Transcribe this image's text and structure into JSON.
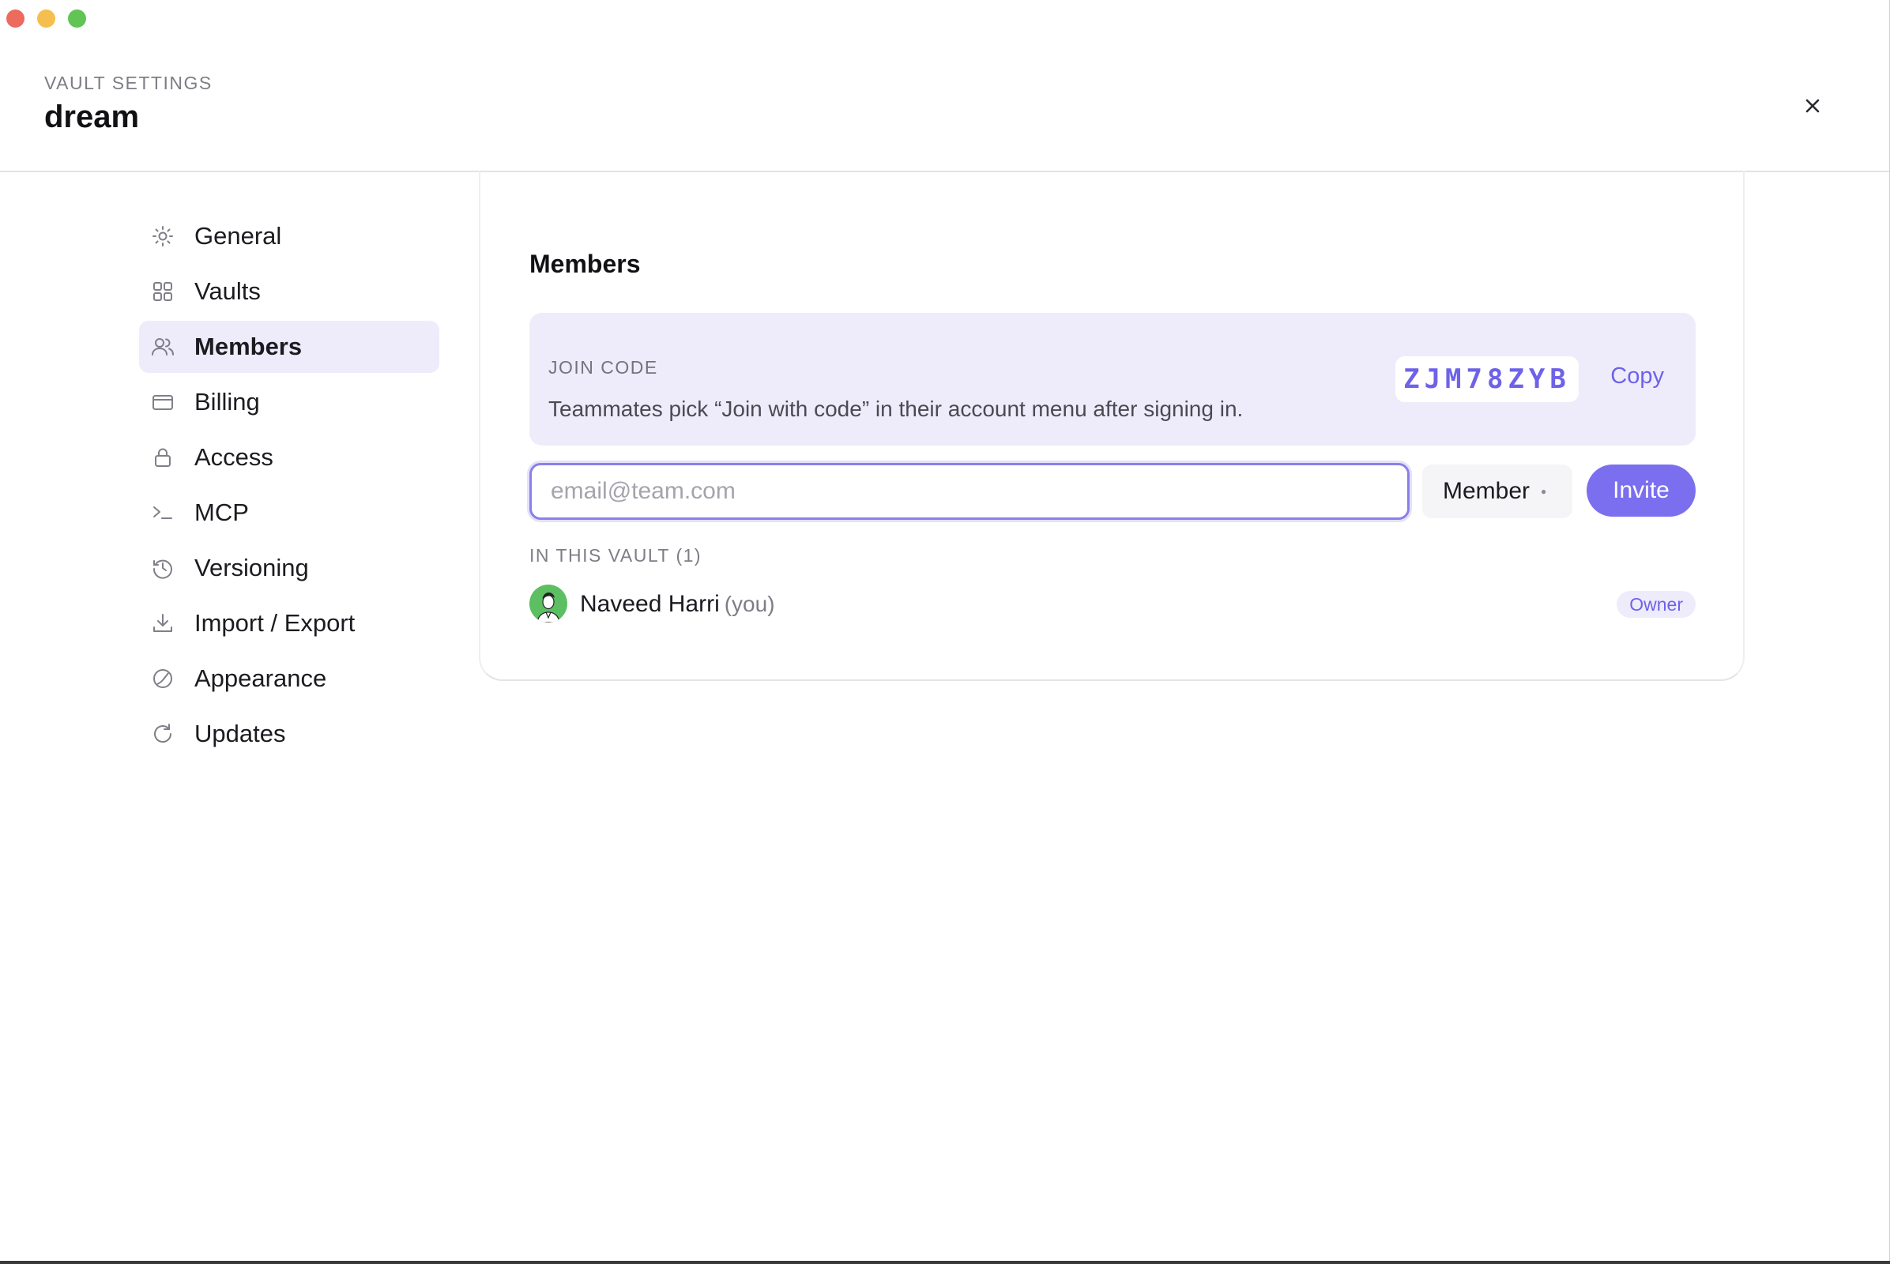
{
  "window": {
    "controls": [
      "close",
      "minimize",
      "maximize"
    ]
  },
  "header": {
    "eyebrow": "VAULT SETTINGS",
    "title": "dream",
    "close_icon": "close-icon"
  },
  "sidebar": {
    "items": [
      {
        "label": "General",
        "icon": "sun-icon",
        "active": false
      },
      {
        "label": "Vaults",
        "icon": "grid-icon",
        "active": false
      },
      {
        "label": "Members",
        "icon": "users-icon",
        "active": true
      },
      {
        "label": "Billing",
        "icon": "credit-card-icon",
        "active": false
      },
      {
        "label": "Access",
        "icon": "lock-icon",
        "active": false
      },
      {
        "label": "MCP",
        "icon": "terminal-icon",
        "active": false
      },
      {
        "label": "Versioning",
        "icon": "history-icon",
        "active": false
      },
      {
        "label": "Import / Export",
        "icon": "download-icon",
        "active": false
      },
      {
        "label": "Appearance",
        "icon": "palette-icon",
        "active": false
      },
      {
        "label": "Updates",
        "icon": "refresh-icon",
        "active": false
      }
    ]
  },
  "main": {
    "title": "Members",
    "join": {
      "label": "JOIN CODE",
      "description": "Teammates pick “Join with code” in their account menu after signing in.",
      "code": "ZJM78ZYB",
      "copy_label": "Copy"
    },
    "invite": {
      "email_placeholder": "email@team.com",
      "email_value": "",
      "role_value": "Member",
      "button_label": "Invite"
    },
    "vault_members_label": "IN THIS VAULT (1)",
    "members": [
      {
        "name": "Naveed Harri",
        "suffix": "(you)",
        "role": "Owner"
      }
    ]
  },
  "colors": {
    "accent": "#7b6ff0",
    "accent_text": "#6e62e8",
    "accent_bg": "#eeecfb",
    "avatar_bg": "#5cbf62"
  }
}
